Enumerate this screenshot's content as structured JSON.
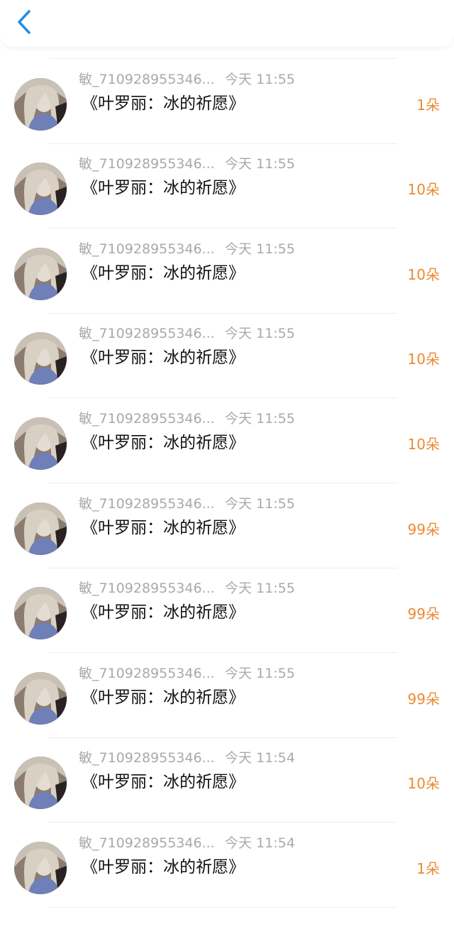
{
  "header": {
    "back_icon": "chevron-left-icon",
    "accent_color": "#1f8fe0"
  },
  "gift_color": "#ec8a33",
  "records": [
    {
      "title": "《叶罗丽：冰的祈愿》",
      "amount": "1朵"
    },
    {
      "name": "敏_710928955346...",
      "time": "今天 11:55",
      "title": "《叶罗丽：冰的祈愿》",
      "amount": "1朵"
    },
    {
      "name": "敏_710928955346...",
      "time": "今天 11:55",
      "title": "《叶罗丽：冰的祈愿》",
      "amount": "10朵"
    },
    {
      "name": "敏_710928955346...",
      "time": "今天 11:55",
      "title": "《叶罗丽：冰的祈愿》",
      "amount": "10朵"
    },
    {
      "name": "敏_710928955346...",
      "time": "今天 11:55",
      "title": "《叶罗丽：冰的祈愿》",
      "amount": "10朵"
    },
    {
      "name": "敏_710928955346...",
      "time": "今天 11:55",
      "title": "《叶罗丽：冰的祈愿》",
      "amount": "10朵"
    },
    {
      "name": "敏_710928955346...",
      "time": "今天 11:55",
      "title": "《叶罗丽：冰的祈愿》",
      "amount": "99朵"
    },
    {
      "name": "敏_710928955346...",
      "time": "今天 11:55",
      "title": "《叶罗丽：冰的祈愿》",
      "amount": "99朵"
    },
    {
      "name": "敏_710928955346...",
      "time": "今天 11:55",
      "title": "《叶罗丽：冰的祈愿》",
      "amount": "99朵"
    },
    {
      "name": "敏_710928955346...",
      "time": "今天 11:54",
      "title": "《叶罗丽：冰的祈愿》",
      "amount": "10朵"
    },
    {
      "name": "敏_710928955346...",
      "time": "今天 11:54",
      "title": "《叶罗丽：冰的祈愿》",
      "amount": "1朵"
    }
  ]
}
